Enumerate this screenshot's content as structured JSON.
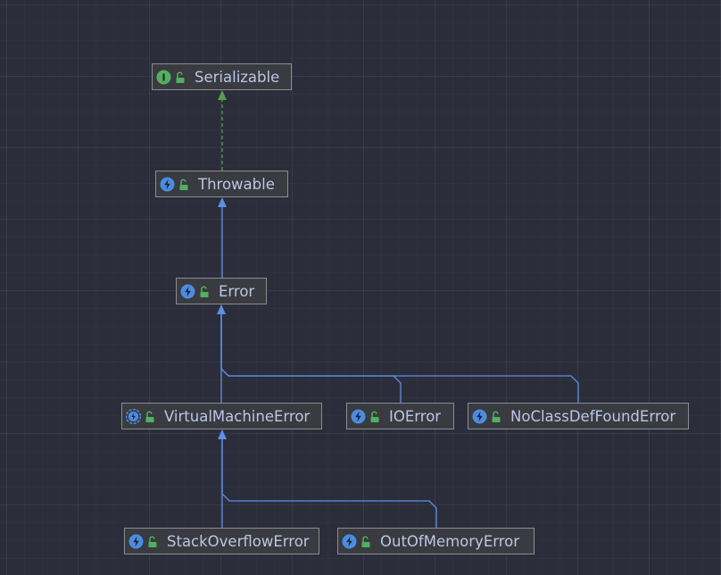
{
  "diagram": {
    "nodes": [
      {
        "id": "serializable",
        "label": "Serializable",
        "kind": "interface"
      },
      {
        "id": "throwable",
        "label": "Throwable",
        "kind": "class"
      },
      {
        "id": "error",
        "label": "Error",
        "kind": "class"
      },
      {
        "id": "virtualmachineerror",
        "label": "VirtualMachineError",
        "kind": "abstract-class"
      },
      {
        "id": "ioerror",
        "label": "IOError",
        "kind": "class"
      },
      {
        "id": "noclassdeffounderror",
        "label": "NoClassDefFoundError",
        "kind": "class"
      },
      {
        "id": "stackoverflowerror",
        "label": "StackOverflowError",
        "kind": "class"
      },
      {
        "id": "outofmemoryerror",
        "label": "OutOfMemoryError",
        "kind": "class"
      }
    ],
    "edges": [
      {
        "from": "throwable",
        "to": "serializable",
        "type": "implements"
      },
      {
        "from": "error",
        "to": "throwable",
        "type": "extends"
      },
      {
        "from": "virtualmachineerror",
        "to": "error",
        "type": "extends"
      },
      {
        "from": "ioerror",
        "to": "error",
        "type": "extends"
      },
      {
        "from": "noclassdeffounderror",
        "to": "error",
        "type": "extends"
      },
      {
        "from": "stackoverflowerror",
        "to": "virtualmachineerror",
        "type": "extends"
      },
      {
        "from": "outofmemoryerror",
        "to": "virtualmachineerror",
        "type": "extends"
      }
    ],
    "colors": {
      "interface_icon": "#4fb160",
      "class_icon": "#4c8ce0",
      "lock_icon": "#4fb160",
      "extends_edge": "#5c91e6",
      "implements_edge": "#5c9a54",
      "node_text": "#bcc6e4",
      "node_border": "#8a8d94",
      "node_bg": "#393b40"
    },
    "icons": {
      "interface": "interface-icon",
      "class": "class-icon",
      "abstract-class": "abstract-class-icon",
      "lock": "lock-open-icon"
    }
  }
}
